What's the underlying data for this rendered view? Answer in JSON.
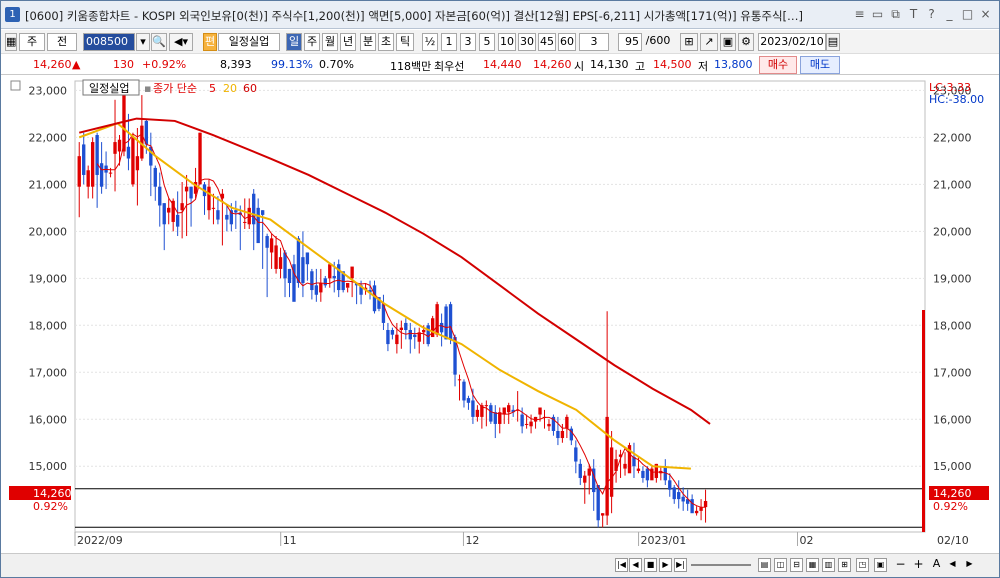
{
  "window": {
    "num": "1",
    "title": "[0600] 키움종합차트 - KOSPI 외국인보유[0(천)] 주식수[1,200(천)] 액면[5,000] 자본금[60(억)] 결산[12월] EPS[-6,211] 시가총액[171(억)] 유통주식[…]",
    "controls": [
      "≡",
      "▭",
      "⧉",
      "T",
      "?",
      "_",
      "□",
      "×"
    ]
  },
  "toolbar": {
    "period_main": "주",
    "period_sub": "전",
    "code": "008500",
    "stock_name": "일정실업",
    "badge": "편",
    "timeframes": [
      "일",
      "주",
      "월",
      "년",
      "분",
      "초",
      "틱"
    ],
    "half": "½",
    "nums": [
      "1",
      "3",
      "5",
      "10",
      "30",
      "45",
      "60"
    ],
    "spin": "3",
    "count": "95",
    "count_total": "/600",
    "date": "2023/02/10"
  },
  "infobar": {
    "price": "14,260",
    "arrow": "▲",
    "change": "130",
    "change_pct": "+0.92%",
    "volume": "8,393",
    "vol_ratio": "99.13%",
    "turnover": "0.70%",
    "amount": "118백만",
    "pref_label": "최우선",
    "ask": "14,440",
    "bid": "14,260",
    "open_label": "시",
    "open": "14,130",
    "high_label": "고",
    "high": "14,500",
    "low_label": "저",
    "low": "13,800",
    "buy": "매수",
    "sell": "매도"
  },
  "chart_data": {
    "type": "candlestick",
    "legend": {
      "name": "일정실업",
      "ma_label": "종가 단순",
      "ma": [
        "5",
        "20",
        "60"
      ]
    },
    "lc": "LC:3.33",
    "hc": "HC:-38.00",
    "current_price": "14,260",
    "current_pct": "0.92%",
    "y_ticks": [
      "23,000",
      "22,000",
      "21,000",
      "20,000",
      "19,000",
      "18,000",
      "17,000",
      "16,000",
      "15,000"
    ],
    "x_labels": [
      "2022/09",
      "11",
      "12",
      "2023/01",
      "02",
      "02/10"
    ],
    "ylim": [
      13600,
      23200
    ],
    "hlines": [
      14520,
      13700
    ],
    "colors": {
      "up": "#e00000",
      "down": "#1e50d2",
      "ma5": "#e00000",
      "ma20": "#f0b400",
      "ma60": "#d20000"
    },
    "candles": [
      [
        20950,
        21600,
        20300,
        21900
      ],
      [
        21850,
        21200,
        21000,
        22100
      ],
      [
        20950,
        21300,
        20700,
        21400
      ],
      [
        20950,
        21900,
        20700,
        22000
      ],
      [
        22050,
        21200,
        20500,
        22100
      ],
      [
        21450,
        20950,
        20800,
        21900
      ],
      [
        21400,
        21250,
        20900,
        21700
      ],
      [
        21250,
        21250,
        21150,
        21350
      ],
      [
        21650,
        21900,
        20850,
        22800
      ],
      [
        21700,
        21950,
        21400,
        22050
      ],
      [
        21700,
        22950,
        21600,
        23000
      ],
      [
        21800,
        21550,
        21300,
        22500
      ],
      [
        21000,
        22000,
        20950,
        22100
      ],
      [
        21300,
        21600,
        20550,
        22200
      ],
      [
        21550,
        22250,
        21500,
        22900
      ],
      [
        22350,
        21850,
        21650,
        22400
      ],
      [
        21800,
        21400,
        20750,
        22100
      ],
      [
        21350,
        20950,
        20650,
        21400
      ],
      [
        20950,
        20550,
        20100,
        21250
      ],
      [
        20600,
        20150,
        19600,
        20600
      ],
      [
        20400,
        20500,
        20150,
        20700
      ],
      [
        20200,
        20650,
        20000,
        20700
      ],
      [
        20350,
        20100,
        19900,
        20850
      ],
      [
        20450,
        20600,
        19850,
        21050
      ],
      [
        20850,
        20950,
        19900,
        21200
      ],
      [
        20950,
        20700,
        20100,
        20950
      ],
      [
        20800,
        21050,
        20700,
        21350
      ],
      [
        21000,
        22100,
        21000,
        22100
      ],
      [
        21000,
        20750,
        20350,
        21050
      ],
      [
        20450,
        20950,
        20250,
        21100
      ],
      [
        20500,
        20500,
        20150,
        20800
      ],
      [
        20450,
        20250,
        20150,
        20750
      ],
      [
        20700,
        20800,
        19700,
        20900
      ],
      [
        20350,
        20250,
        20000,
        20550
      ],
      [
        20450,
        20150,
        20000,
        20600
      ],
      [
        20450,
        20400,
        20050,
        20650
      ],
      [
        20400,
        20350,
        19600,
        20550
      ],
      [
        20200,
        20200,
        20050,
        20700
      ],
      [
        20150,
        20500,
        20050,
        20700
      ],
      [
        20800,
        20150,
        19600,
        20900
      ],
      [
        20500,
        19750,
        19800,
        20700
      ],
      [
        20450,
        20350,
        19200,
        20450
      ],
      [
        19900,
        19650,
        18600,
        19950
      ],
      [
        19550,
        19850,
        19200,
        19950
      ],
      [
        19200,
        19700,
        19100,
        19900
      ],
      [
        19200,
        19450,
        19000,
        19650
      ],
      [
        19550,
        19000,
        18600,
        19600
      ],
      [
        19200,
        18900,
        18600,
        19200
      ],
      [
        19300,
        18500,
        18800,
        19500
      ],
      [
        19850,
        18900,
        18800,
        19900
      ],
      [
        19450,
        18900,
        18600,
        20000
      ],
      [
        19550,
        19300,
        18950,
        19550
      ],
      [
        19150,
        18750,
        18550,
        19200
      ],
      [
        18850,
        18650,
        18500,
        19200
      ],
      [
        18700,
        18900,
        18500,
        19200
      ],
      [
        19000,
        18850,
        18800,
        19050
      ],
      [
        19000,
        19300,
        18800,
        19150
      ],
      [
        19050,
        19000,
        18700,
        19350
      ],
      [
        19300,
        18750,
        18600,
        19400
      ],
      [
        19150,
        18750,
        18700,
        19100
      ],
      [
        18800,
        18900,
        18700,
        18800
      ],
      [
        19000,
        19250,
        18600,
        19100
      ],
      [
        18900,
        18850,
        18450,
        18900
      ],
      [
        18850,
        18650,
        18450,
        18950
      ],
      [
        18750,
        18800,
        18650,
        18900
      ],
      [
        18750,
        18700,
        18550,
        18950
      ],
      [
        18850,
        18300,
        18250,
        18950
      ],
      [
        18600,
        18350,
        18300,
        18500
      ],
      [
        18450,
        18050,
        17900,
        18650
      ],
      [
        17900,
        17600,
        17450,
        18050
      ],
      [
        17900,
        17800,
        17700,
        17950
      ],
      [
        17600,
        17800,
        17400,
        18050
      ],
      [
        17900,
        17950,
        17500,
        18100
      ],
      [
        18050,
        17900,
        17700,
        18150
      ],
      [
        17900,
        17700,
        17400,
        18050
      ],
      [
        17800,
        17750,
        17500,
        17950
      ],
      [
        17650,
        17850,
        17400,
        17950
      ],
      [
        17850,
        17900,
        17600,
        18000
      ],
      [
        18000,
        17600,
        17550,
        18050
      ],
      [
        17750,
        18150,
        17800,
        18200
      ],
      [
        17800,
        18450,
        17750,
        18500
      ],
      [
        18050,
        17850,
        17550,
        18250
      ],
      [
        18400,
        17700,
        17700,
        18450
      ],
      [
        18450,
        17700,
        17600,
        18500
      ],
      [
        17750,
        16950,
        16700,
        17800
      ],
      [
        16850,
        16850,
        16400,
        16950
      ],
      [
        16800,
        16400,
        16250,
        16850
      ],
      [
        16450,
        16350,
        16200,
        16500
      ],
      [
        16400,
        16050,
        15900,
        16650
      ],
      [
        16050,
        16200,
        15950,
        16300
      ],
      [
        16050,
        16300,
        15800,
        16350
      ],
      [
        16300,
        16300,
        15850,
        16400
      ],
      [
        16300,
        15950,
        15900,
        16350
      ],
      [
        16150,
        15900,
        15600,
        16300
      ],
      [
        15900,
        16150,
        15700,
        16250
      ],
      [
        16100,
        16250,
        15900,
        16200
      ],
      [
        16150,
        16300,
        15900,
        16350
      ],
      [
        16200,
        16150,
        16050,
        16300
      ],
      [
        16200,
        16200,
        15950,
        16600
      ],
      [
        16100,
        15850,
        15700,
        16250
      ],
      [
        15900,
        15900,
        15800,
        16100
      ],
      [
        15850,
        15950,
        15700,
        16100
      ],
      [
        15950,
        16050,
        15800,
        16050
      ],
      [
        16100,
        16250,
        15950,
        16150
      ],
      [
        16050,
        16050,
        15800,
        16200
      ],
      [
        15850,
        15900,
        15750,
        16000
      ],
      [
        16050,
        15750,
        15650,
        16100
      ],
      [
        15750,
        15600,
        15450,
        16050
      ],
      [
        15600,
        15750,
        15500,
        15900
      ],
      [
        15800,
        16050,
        15600,
        16100
      ],
      [
        15800,
        15550,
        15450,
        15850
      ],
      [
        15400,
        15100,
        14850,
        15550
      ],
      [
        15050,
        14750,
        14600,
        15150
      ],
      [
        14650,
        14800,
        14200,
        14900
      ],
      [
        14800,
        14950,
        14400,
        15050
      ],
      [
        14950,
        14450,
        14050,
        15150
      ],
      [
        14600,
        13850,
        13700,
        14600
      ],
      [
        13950,
        14000,
        13700,
        14000
      ],
      [
        13950,
        16050,
        13750,
        18300
      ],
      [
        14350,
        15400,
        14000,
        15750
      ],
      [
        14900,
        15150,
        14650,
        15350
      ],
      [
        15200,
        15250,
        14750,
        15350
      ],
      [
        14950,
        15050,
        14800,
        15300
      ],
      [
        14850,
        15450,
        14900,
        15500
      ],
      [
        15200,
        15000,
        14750,
        15500
      ],
      [
        14900,
        14950,
        14850,
        15200
      ],
      [
        14900,
        14750,
        14650,
        15000
      ],
      [
        14950,
        14700,
        14550,
        15000
      ],
      [
        14700,
        14950,
        14750,
        15000
      ],
      [
        14750,
        15050,
        14650,
        15050
      ],
      [
        14850,
        14900,
        14700,
        15000
      ],
      [
        15000,
        14700,
        14600,
        15150
      ],
      [
        14700,
        14500,
        14350,
        14850
      ],
      [
        14550,
        14300,
        14200,
        14600
      ],
      [
        14450,
        14300,
        14100,
        14700
      ],
      [
        14350,
        14250,
        14050,
        14550
      ],
      [
        14300,
        14200,
        14050,
        14500
      ],
      [
        14300,
        14000,
        14100,
        14400
      ],
      [
        14000,
        14050,
        13950,
        14150
      ],
      [
        14050,
        14130,
        13850,
        14300
      ],
      [
        14130,
        14260,
        13800,
        14500
      ]
    ],
    "ma20": [
      [
        0,
        22000
      ],
      [
        10,
        22300
      ],
      [
        20,
        21600
      ],
      [
        30,
        21000
      ],
      [
        40,
        20500
      ],
      [
        50,
        20250
      ],
      [
        60,
        19650
      ],
      [
        70,
        19050
      ],
      [
        80,
        18450
      ],
      [
        90,
        17950
      ],
      [
        100,
        17600
      ],
      [
        110,
        17050
      ],
      [
        120,
        16600
      ],
      [
        130,
        16200
      ],
      [
        140,
        15550
      ],
      [
        150,
        15000
      ],
      [
        160,
        14950
      ]
    ],
    "ma60": [
      [
        0,
        22100
      ],
      [
        15,
        22400
      ],
      [
        25,
        22350
      ],
      [
        35,
        22050
      ],
      [
        50,
        21550
      ],
      [
        60,
        21200
      ],
      [
        70,
        20800
      ],
      [
        80,
        20400
      ],
      [
        90,
        19950
      ],
      [
        100,
        19450
      ],
      [
        110,
        18850
      ],
      [
        120,
        18250
      ],
      [
        130,
        17700
      ],
      [
        140,
        17150
      ],
      [
        150,
        16650
      ],
      [
        160,
        16200
      ],
      [
        165,
        15900
      ]
    ]
  }
}
